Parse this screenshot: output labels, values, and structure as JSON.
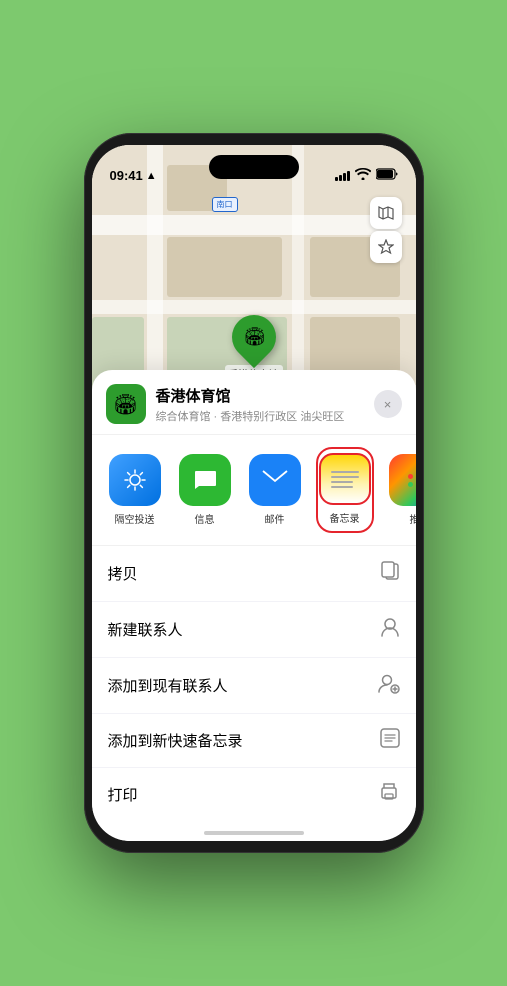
{
  "status_bar": {
    "time": "09:41",
    "location_arrow": "▶"
  },
  "map": {
    "entrance_label": "南口",
    "venue_pin_label": "香港体育馆",
    "controls": {
      "map_type": "🗺",
      "location": "➤"
    }
  },
  "sheet": {
    "venue_name": "香港体育馆",
    "venue_subtitle": "综合体育馆 · 香港特别行政区 油尖旺区",
    "close_label": "×",
    "share_items": [
      {
        "id": "airdrop",
        "label": "隔空投送"
      },
      {
        "id": "messages",
        "label": "信息"
      },
      {
        "id": "mail",
        "label": "邮件"
      },
      {
        "id": "notes",
        "label": "备忘录"
      },
      {
        "id": "more",
        "label": "推"
      }
    ],
    "menu_items": [
      {
        "label": "拷贝",
        "icon": "copy"
      },
      {
        "label": "新建联系人",
        "icon": "person"
      },
      {
        "label": "添加到现有联系人",
        "icon": "person-add"
      },
      {
        "label": "添加到新快速备忘录",
        "icon": "note"
      },
      {
        "label": "打印",
        "icon": "print"
      }
    ]
  },
  "icons": {
    "copy": "⿻",
    "person": "👤",
    "person_add": "🧑",
    "note": "📋",
    "print": "🖨"
  }
}
